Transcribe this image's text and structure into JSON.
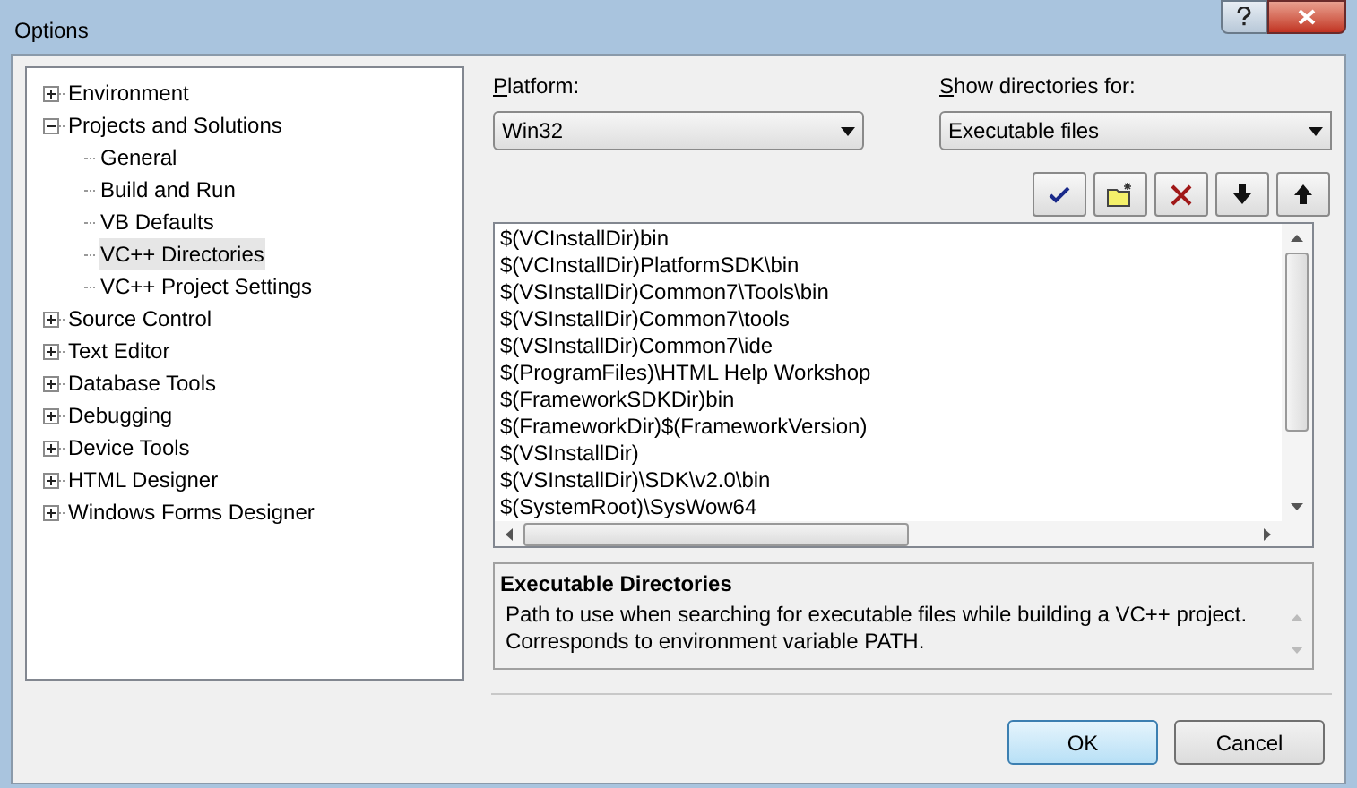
{
  "window": {
    "title": "Options"
  },
  "tree": [
    {
      "label": "Environment",
      "expanded": false,
      "selected": false
    },
    {
      "label": "Projects and Solutions",
      "expanded": true,
      "selected": false,
      "children": [
        {
          "label": "General",
          "selected": false
        },
        {
          "label": "Build and Run",
          "selected": false
        },
        {
          "label": "VB Defaults",
          "selected": false
        },
        {
          "label": "VC++ Directories",
          "selected": true
        },
        {
          "label": "VC++ Project Settings",
          "selected": false
        }
      ]
    },
    {
      "label": "Source Control",
      "expanded": false,
      "selected": false
    },
    {
      "label": "Text Editor",
      "expanded": false,
      "selected": false
    },
    {
      "label": "Database Tools",
      "expanded": false,
      "selected": false
    },
    {
      "label": "Debugging",
      "expanded": false,
      "selected": false
    },
    {
      "label": "Device Tools",
      "expanded": false,
      "selected": false
    },
    {
      "label": "HTML Designer",
      "expanded": false,
      "selected": false
    },
    {
      "label": "Windows Forms Designer",
      "expanded": false,
      "selected": false
    }
  ],
  "platform": {
    "label": "Platform:",
    "value": "Win32"
  },
  "show_directories_for": {
    "label": "Show directories for:",
    "value": "Executable files"
  },
  "toolbar": [
    {
      "kind": "check"
    },
    {
      "kind": "folder"
    },
    {
      "kind": "delete"
    },
    {
      "kind": "down"
    },
    {
      "kind": "up"
    }
  ],
  "directories": [
    "$(VCInstallDir)bin",
    "$(VCInstallDir)PlatformSDK\\bin",
    "$(VSInstallDir)Common7\\Tools\\bin",
    "$(VSInstallDir)Common7\\tools",
    "$(VSInstallDir)Common7\\ide",
    "$(ProgramFiles)\\HTML Help Workshop",
    "$(FrameworkSDKDir)bin",
    "$(FrameworkDir)$(FrameworkVersion)",
    "$(VSInstallDir)",
    "$(VSInstallDir)\\SDK\\v2.0\\bin",
    "$(SystemRoot)\\SysWow64"
  ],
  "description": {
    "title": "Executable Directories",
    "text": "Path to use when searching for executable files while building a VC++ project. Corresponds to environment variable PATH."
  },
  "buttons": [
    {
      "label": "OK",
      "default": true
    },
    {
      "label": "Cancel",
      "default": false
    }
  ]
}
